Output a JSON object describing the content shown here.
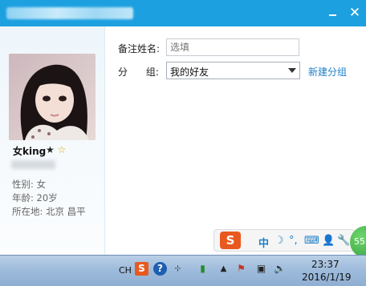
{
  "window": {
    "minimize_icon": "minimize-icon",
    "close_symbol": "✕"
  },
  "profile": {
    "nickname": "女king",
    "star_black": "★",
    "star_gold": "☆",
    "gender": "性别: 女",
    "age": "年龄: 20岁",
    "location": "所在地: 北京  昌平"
  },
  "form": {
    "remark_label": "备注姓名:",
    "remark_placeholder": "选填",
    "group_label": "分      组:",
    "group_value": "我的好友",
    "new_group_link": "新建分组"
  },
  "ime": {
    "logo": "S",
    "mode": "中",
    "moon": "☽",
    "punct": "°,",
    "keyboard": "⌨",
    "user": "👤",
    "wrench": "🔧",
    "badge": "55"
  },
  "taskbar": {
    "lang": "CH",
    "clock_time": "23:37",
    "clock_date": "2016/1/19"
  },
  "colors": {
    "titlebar": "#1da0e0",
    "link": "#1e7fc7"
  }
}
